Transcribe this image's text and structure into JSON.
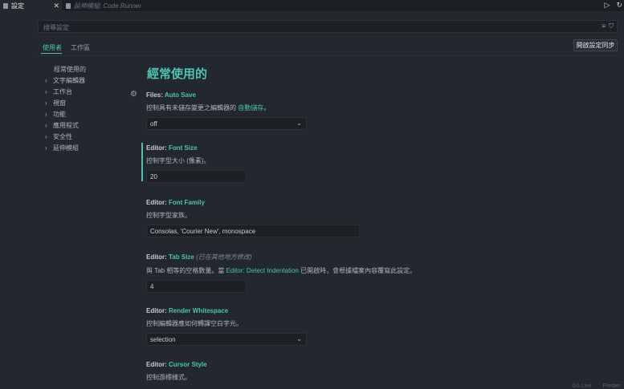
{
  "tabs": [
    {
      "label": "設定",
      "active": true
    },
    {
      "label": "延伸模組: Code Runner",
      "active": false
    }
  ],
  "search": {
    "placeholder": "搜尋設定"
  },
  "scopes": {
    "user": "使用者",
    "workspace": "工作區"
  },
  "sync_button": "開啟設定同步",
  "tree": [
    {
      "label": "經常使用的",
      "expandable": false
    },
    {
      "label": "文字編輯器",
      "expandable": true
    },
    {
      "label": "工作台",
      "expandable": true
    },
    {
      "label": "視窗",
      "expandable": true
    },
    {
      "label": "功能",
      "expandable": true
    },
    {
      "label": "應用程式",
      "expandable": true
    },
    {
      "label": "安全性",
      "expandable": true
    },
    {
      "label": "延伸模組",
      "expandable": true
    }
  ],
  "main": {
    "heading": "經常使用的",
    "settings": [
      {
        "category": "Files: ",
        "name": "Auto Save",
        "desc_pre": "控制具有未儲存變更之編輯器的 ",
        "desc_link": "自動儲存",
        "desc_post": "。",
        "value": "off",
        "type": "select"
      },
      {
        "category": "Editor: ",
        "name": "Font Size",
        "desc": "控制字型大小 (像素)。",
        "value": "20",
        "type": "input"
      },
      {
        "category": "Editor: ",
        "name": "Font Family",
        "desc": "控制字型家族。",
        "value": "Consolas, 'Courier New', monospace",
        "type": "input"
      },
      {
        "category": "Editor: ",
        "name": "Tab Size",
        "modified": "(已在其他地方修改)",
        "desc_pre": "與 Tab 相等的空格數量。當 ",
        "desc_link": "Editor: Detect Indentation",
        "desc_post": " 已開啟時，會根據檔案內容覆寫此設定。",
        "value": "4",
        "type": "input"
      },
      {
        "category": "Editor: ",
        "name": "Render Whitespace",
        "desc": "控制編輯器應如何轉譯空白字元。",
        "value": "selection",
        "type": "select"
      },
      {
        "category": "Editor: ",
        "name": "Cursor Style",
        "desc": "控制游標樣式。"
      }
    ]
  },
  "status": [
    "Go Live",
    "Prettier"
  ]
}
